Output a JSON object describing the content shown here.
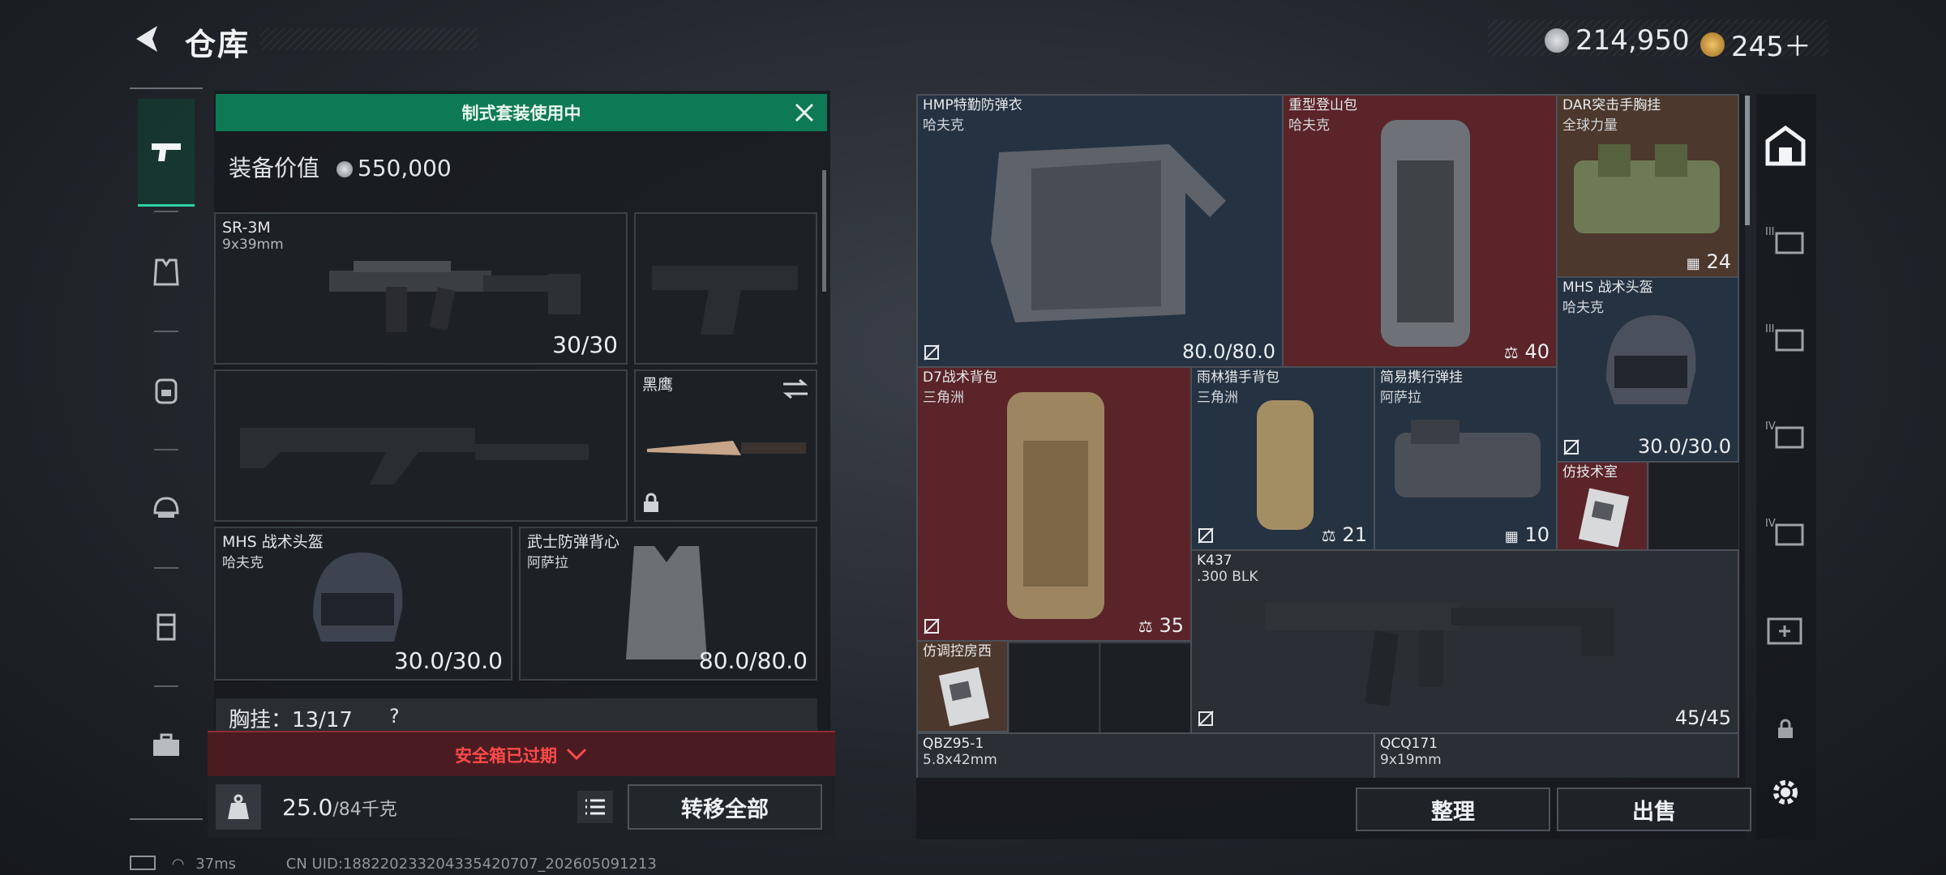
{
  "header": {
    "title": "仓库",
    "currency": [
      {
        "icon": "silver-coin-icon",
        "value": "214,950",
        "color": "#c9ccd0"
      },
      {
        "icon": "gold-coin-icon",
        "value": "245＋",
        "color": "#d9a441"
      }
    ]
  },
  "left_rail": {
    "tabs": [
      {
        "icon": "pistol-icon",
        "active": true
      },
      {
        "icon": "vest-icon"
      },
      {
        "icon": "backpack-icon"
      },
      {
        "icon": "helmet-icon"
      },
      {
        "icon": "chest-rig-icon"
      },
      {
        "icon": "toolbox-icon"
      }
    ]
  },
  "loadout": {
    "banner": "制式套装使用中",
    "equip_value_label": "装备价值",
    "equip_value": "550,000",
    "slots": {
      "primary": {
        "name": "SR-3M",
        "caliber": "9x39mm",
        "ammo": "30/30"
      },
      "pistol": {
        "name": ""
      },
      "secondary": {
        "name": ""
      },
      "melee": {
        "name": "黑鹰"
      },
      "helmet": {
        "name": "MHS 战术头盔",
        "brand": "哈夫克",
        "durability": "30.0/30.0"
      },
      "armor": {
        "name": "武士防弹背心",
        "brand": "阿萨拉",
        "durability": "80.0/80.0"
      }
    },
    "chest_rig": "胸挂：13/17",
    "chest_help": "?",
    "safe_box": "安全箱已过期",
    "weight_value": "25.0",
    "weight_unit": "/84千克",
    "transfer_all": "转移全部"
  },
  "storage": {
    "items": [
      {
        "name": "HMP特勤防弹衣",
        "brand": "哈夫克",
        "value": "80.0/80.0",
        "color": "blue"
      },
      {
        "name": "重型登山包",
        "brand": "哈夫克",
        "value": "40",
        "color": "red"
      },
      {
        "name": "DAR突击手胸挂",
        "brand": "全球力量",
        "value": "24",
        "color": "brown"
      },
      {
        "name": "MHS 战术头盔",
        "brand": "哈夫克",
        "value": "30.0/30.0",
        "color": "blue"
      },
      {
        "name": "D7战术背包",
        "brand": "三角洲",
        "value": "35",
        "color": "red"
      },
      {
        "name": "雨林猎手背包",
        "brand": "三角洲",
        "value": "21",
        "color": "blue"
      },
      {
        "name": "简易携行弹挂",
        "brand": "阿萨拉",
        "value": "10",
        "color": "blue"
      },
      {
        "name": "仿技术室",
        "brand": "",
        "value": "",
        "color": "red"
      },
      {
        "name": "K437",
        "brand": ".300 BLK",
        "value": "45/45",
        "color": "dark"
      },
      {
        "name": "仿调控房西",
        "brand": "",
        "value": "",
        "color": "brown"
      },
      {
        "name": "QBZ95-1",
        "brand": "5.8x42mm",
        "value": "",
        "color": "dark"
      },
      {
        "name": "QCQ171",
        "brand": "9x19mm",
        "value": "",
        "color": "dark"
      }
    ],
    "sort": "整理",
    "sell": "出售"
  },
  "status_bar": {
    "ping": "37ms",
    "uid": "CN UID:18822023320433542070​7_202605091213"
  }
}
